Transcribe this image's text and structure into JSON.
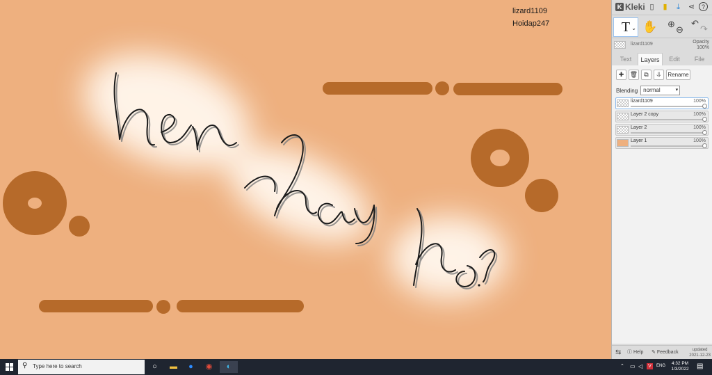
{
  "canvas": {
    "background_color": "#eeb07f",
    "accent_color": "#b66a2a",
    "watermark_line1": "lizard1109",
    "watermark_line2": "Hoidap247",
    "handwriting": "hen hay ko?"
  },
  "header": {
    "logo_text": "Kleki",
    "icons": [
      "new-file-icon",
      "save-icon",
      "download-icon",
      "share-icon",
      "help-icon"
    ]
  },
  "tools": {
    "text_tool_label": "T",
    "hand_tool_icon": "hand-icon",
    "zoom_in_icon": "zoom-in-icon",
    "zoom_out_icon": "zoom-out-icon",
    "undo_icon": "undo-icon",
    "redo_icon": "redo-icon"
  },
  "current_layer": {
    "name": "lizard1109",
    "opacity_label": "Opacity",
    "opacity_value": "100%"
  },
  "tabs": [
    {
      "label": "Text"
    },
    {
      "label": "Layers"
    },
    {
      "label": "Edit"
    },
    {
      "label": "File"
    }
  ],
  "layers_panel": {
    "rename_label": "Rename",
    "blending_label": "Blending",
    "blending_value": "normal",
    "layers": [
      {
        "name": "lizard1109",
        "opacity": "100%"
      },
      {
        "name": "Layer 2 copy",
        "opacity": "100%"
      },
      {
        "name": "Layer 2",
        "opacity": "100%"
      },
      {
        "name": "Layer 1",
        "opacity": "100%"
      }
    ]
  },
  "footer": {
    "help_label": "Help",
    "feedback_label": "Feedback",
    "updated_label": "updated",
    "updated_date": "2021-12-23"
  },
  "taskbar": {
    "search_placeholder": "Type here to search",
    "language": "ENG",
    "time": "4:32 PM",
    "date": "1/3/2022"
  }
}
